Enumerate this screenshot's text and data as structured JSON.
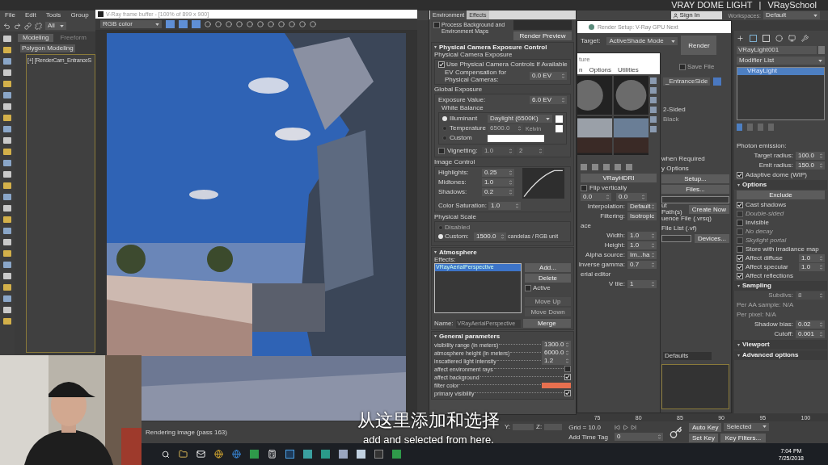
{
  "header": {
    "title": "VRAY DOME LIGHT",
    "separator": "|",
    "brand": "VRaySchool"
  },
  "menu": [
    "File",
    "Edit",
    "Tools",
    "Group"
  ],
  "sign_in": "Sign In",
  "workspaces": {
    "label": "Workspaces:",
    "value": "Default"
  },
  "selection_filter": "All",
  "ribbon_tabs": [
    {
      "label": "Modeling",
      "selected": true
    },
    {
      "label": "Freeform",
      "selected": false
    }
  ],
  "ribbon_panel": "Polygon Modeling",
  "viewport_label": "[+] [RenderCam_EntranceS",
  "frame_buffer": {
    "title": "V-Ray frame buffer - [100% of 899 x 900]",
    "channel": "RGB color",
    "status": "Rendering image (pass 163)"
  },
  "environment": {
    "tabs": [
      {
        "label": "Environment",
        "selected": true
      },
      {
        "label": "Effects",
        "selected": false
      }
    ],
    "process_maps": {
      "label": "Process Background and Environment Maps",
      "checked": false
    },
    "render_preview": "Render Preview",
    "exposure": {
      "title": "Physical Camera Exposure Control",
      "group": "Physical Camera Exposure",
      "use_physical": {
        "label": "Use Physical Camera Controls If Available",
        "checked": true
      },
      "ev_comp": {
        "label": "EV Compensation for Physical Cameras:",
        "value": "0.0 EV"
      },
      "global": "Global Exposure",
      "exposure_value": {
        "label": "Exposure Value:",
        "value": "6.0 EV"
      },
      "white_balance": "White Balance",
      "wb_options": [
        {
          "kind": "dropdown",
          "label": "Illuminant",
          "selected": true,
          "value": "Daylight (6500K)"
        },
        {
          "kind": "spinner",
          "label": "Temperature",
          "selected": false,
          "value": "6500.0",
          "unit": "Kelvin"
        },
        {
          "kind": "swatch",
          "label": "Custom",
          "selected": false
        }
      ],
      "vignetting": {
        "label": "Vignetting:",
        "checked": false,
        "value": "1.0",
        "value_2": "2"
      },
      "image_control": "Image Control",
      "image_params": [
        {
          "label": "Highlights:",
          "value": "0.25"
        },
        {
          "label": "Midtones:",
          "value": "1.0"
        },
        {
          "label": "Shadows:",
          "value": "0.2"
        },
        {
          "label": "Color Saturation:",
          "value": "1.0"
        }
      ],
      "physical_scale": "Physical Scale",
      "scale_options": [
        {
          "label": "Disabled",
          "selected": false
        },
        {
          "label": "Custom:",
          "selected": true,
          "value": "1500.0",
          "unit": "candelas / RGB unit"
        }
      ]
    },
    "atmosphere": {
      "title": "Atmosphere",
      "effects_label": "Effects:",
      "effects": [
        {
          "label": "VRayAerialPerspective",
          "selected": true
        }
      ],
      "buttons": [
        {
          "label": "Add...",
          "disabled": false
        },
        {
          "label": "Delete",
          "disabled": false
        },
        {
          "label": "Move Up",
          "disabled": true
        },
        {
          "label": "Move Down",
          "disabled": true
        }
      ],
      "active": {
        "label": "Active",
        "checked": false
      },
      "name_label": "Name:",
      "name": "VRayAerialPerspective",
      "merge": "Merge"
    },
    "general": {
      "title": "General parameters",
      "rows": [
        {
          "kind": "spinner",
          "label": "visibility range (in meters)",
          "value": "1300.0"
        },
        {
          "kind": "spinner",
          "label": "atmosphere height (in meters)",
          "value": "6000.0"
        },
        {
          "kind": "spinner",
          "label": "inscattered light intensity",
          "value": "1.2"
        },
        {
          "kind": "checkbox",
          "label": "affect environment rays",
          "checked": false
        },
        {
          "kind": "checkbox",
          "label": "affect background",
          "checked": true
        },
        {
          "kind": "color",
          "label": "filter color",
          "color": "#e8704f"
        },
        {
          "kind": "checkbox",
          "label": "primary visibility",
          "checked": true
        }
      ]
    }
  },
  "render_setup": {
    "title": "Render Setup: V-Ray GPU Next",
    "target_label": "Target:",
    "target": "ActiveShade Mode",
    "render": "Render",
    "save_file": {
      "label": "Save File",
      "checked": false
    },
    "view": "_EntranceSide",
    "rows": [
      {
        "kind": "text",
        "label": "when Required"
      },
      {
        "kind": "text",
        "label": "y Options"
      },
      {
        "kind": "button",
        "label": "Setup..."
      },
      {
        "kind": "button",
        "label": "Files..."
      },
      {
        "kind": "field"
      },
      {
        "kind": "text_button",
        "label": "ut Path(s)",
        "button": "Create Now"
      },
      {
        "kind": "text",
        "label": "uence File (.vrsq)"
      },
      {
        "kind": "text",
        "label": "File List (.vf)"
      },
      {
        "kind": "field_button",
        "button": "Devices..."
      }
    ],
    "defaults": "Defaults"
  },
  "material_editor": {
    "title": "ture",
    "menu": [
      "n",
      "Options",
      "Utilities"
    ],
    "side_texts": [
      "2-Sided",
      "Black"
    ],
    "rows": [
      {
        "kind": "button",
        "label": "VRayHDRI"
      },
      {
        "kind": "check",
        "label": "Flip vertically",
        "checked": false
      },
      {
        "kind": "pair",
        "value": "0.0",
        "value_2": "0.0"
      },
      {
        "kind": "param",
        "label": "Interpolation:",
        "value": "Default"
      },
      {
        "kind": "param",
        "label": "Filtering:",
        "value": "Isotropic"
      },
      {
        "kind": "text",
        "label": "ace"
      },
      {
        "kind": "param",
        "label": "Width:",
        "value": "1.0"
      },
      {
        "kind": "param",
        "label": "Height:",
        "value": "1.0"
      },
      {
        "kind": "param",
        "label": "Alpha source:",
        "value": "Im...ha"
      },
      {
        "kind": "param",
        "label": "Inverse gamma:",
        "value": "0.7"
      },
      {
        "kind": "text",
        "label": "erial editor"
      },
      {
        "kind": "param",
        "label": "V tile:",
        "value": "1"
      }
    ]
  },
  "command_panel": {
    "object_name": "VRayLight001",
    "modifier_list": "Modifier List",
    "stack": [
      {
        "label": "VRayLight",
        "selected": true
      }
    ],
    "rows": [
      {
        "kind": "text",
        "label": "Photon emission:"
      },
      {
        "kind": "param",
        "label": "Target radius:",
        "value": "100.0"
      },
      {
        "kind": "param",
        "label": "Emit radius:",
        "value": "150.0"
      },
      {
        "kind": "check",
        "label": "Adaptive dome (WIP)",
        "checked": true,
        "disabled": false
      },
      {
        "kind": "header",
        "label": "Options"
      },
      {
        "kind": "button",
        "label": "Exclude"
      },
      {
        "kind": "check",
        "label": "Cast shadows",
        "checked": true,
        "disabled": false
      },
      {
        "kind": "check",
        "label": "Double-sided",
        "checked": false,
        "disabled": true
      },
      {
        "kind": "check",
        "label": "Invisible",
        "checked": false,
        "disabled": false
      },
      {
        "kind": "check",
        "label": "No decay",
        "checked": false,
        "disabled": true
      },
      {
        "kind": "check",
        "label": "Skylight portal",
        "checked": false,
        "disabled": true
      },
      {
        "kind": "check",
        "label": "Store with irradiance map",
        "checked": false,
        "disabled": false
      },
      {
        "kind": "check",
        "label": "Affect diffuse",
        "checked": true,
        "disabled": false,
        "value": "1.0"
      },
      {
        "kind": "check",
        "label": "Affect specular",
        "checked": true,
        "disabled": false,
        "value": "1.0"
      },
      {
        "kind": "check",
        "label": "Affect reflections",
        "checked": true,
        "disabled": false
      },
      {
        "kind": "header",
        "label": "Sampling"
      },
      {
        "kind": "param",
        "label": "Subdivs:",
        "value": "8",
        "disabled": true
      },
      {
        "kind": "text",
        "label": "Per AA sample: N/A",
        "disabled": true
      },
      {
        "kind": "text",
        "label": "Per pixel: N/A",
        "disabled": true
      },
      {
        "kind": "param",
        "label": "Shadow bias:",
        "value": "0.02"
      },
      {
        "kind": "param",
        "label": "Cutoff:",
        "value": "0.001"
      },
      {
        "kind": "header",
        "label": "Viewport"
      },
      {
        "kind": "header",
        "label": "Advanced options"
      }
    ]
  },
  "timeline": {
    "ticks": [
      "75",
      "80",
      "85",
      "90",
      "95",
      "100"
    ]
  },
  "status_bar": {
    "y_label": "Y:",
    "z_label": "Z:",
    "grid": "Grid = 10.0",
    "time_tag": "Add Time Tag",
    "frame": "0",
    "auto_key": "Auto Key",
    "key_mode": "Selected",
    "set_key": "Set Key",
    "key_filters": "Key Filters..."
  },
  "taskbar": {
    "time": "7:04 PM",
    "date": "7/25/2018"
  },
  "subtitle": {
    "zh": "从这里添加和选择",
    "en": "add and selected from here."
  }
}
